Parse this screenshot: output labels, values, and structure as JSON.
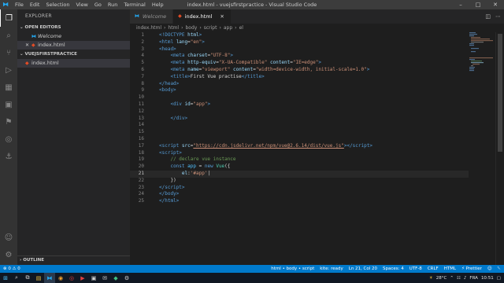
{
  "titlebar": {
    "menu": [
      "File",
      "Edit",
      "Selection",
      "View",
      "Go",
      "Run",
      "Terminal",
      "Help"
    ],
    "title": "index.html - vuejsfirstpractice - Visual Studio Code"
  },
  "sidebar": {
    "header": "EXPLORER",
    "open_editors_label": "OPEN EDITORS",
    "open_editors": [
      "Welcome",
      "index.html"
    ],
    "folder_label": "VUEJSFIRSTPRACTICE",
    "files": [
      "index.html"
    ],
    "outline_label": "OUTLINE"
  },
  "tabs": [
    {
      "label": "Welcome"
    },
    {
      "label": "index.html"
    }
  ],
  "breadcrumbs": [
    "index.html",
    "html",
    "body",
    "script",
    "app",
    "el"
  ],
  "editor": {
    "line_numbers": [
      "1",
      "2",
      "3",
      "4",
      "5",
      "6",
      "7",
      "8",
      "9",
      "10",
      "11",
      "12",
      "13",
      "14",
      "15",
      "16",
      "17",
      "18",
      "19",
      "20",
      "21",
      "22",
      "23",
      "24",
      "25"
    ],
    "cursor_line": 21
  },
  "statusbar": {
    "left": [
      "⊗ 0 ⚠ 0"
    ],
    "right": [
      "html • body • script",
      "Ln 21, Col 20",
      "Spaces: 4",
      "UTF-8",
      "CRLF",
      "HTML",
      "⚡ Prettier"
    ],
    "live": "kite: ready"
  },
  "taskbar": {
    "temp": "28°C",
    "lang": "FRA",
    "time": "10:51"
  },
  "colors": {
    "accent": "#007acc",
    "tag": "#569cd6",
    "attr": "#9cdcfe",
    "string": "#ce9178"
  }
}
